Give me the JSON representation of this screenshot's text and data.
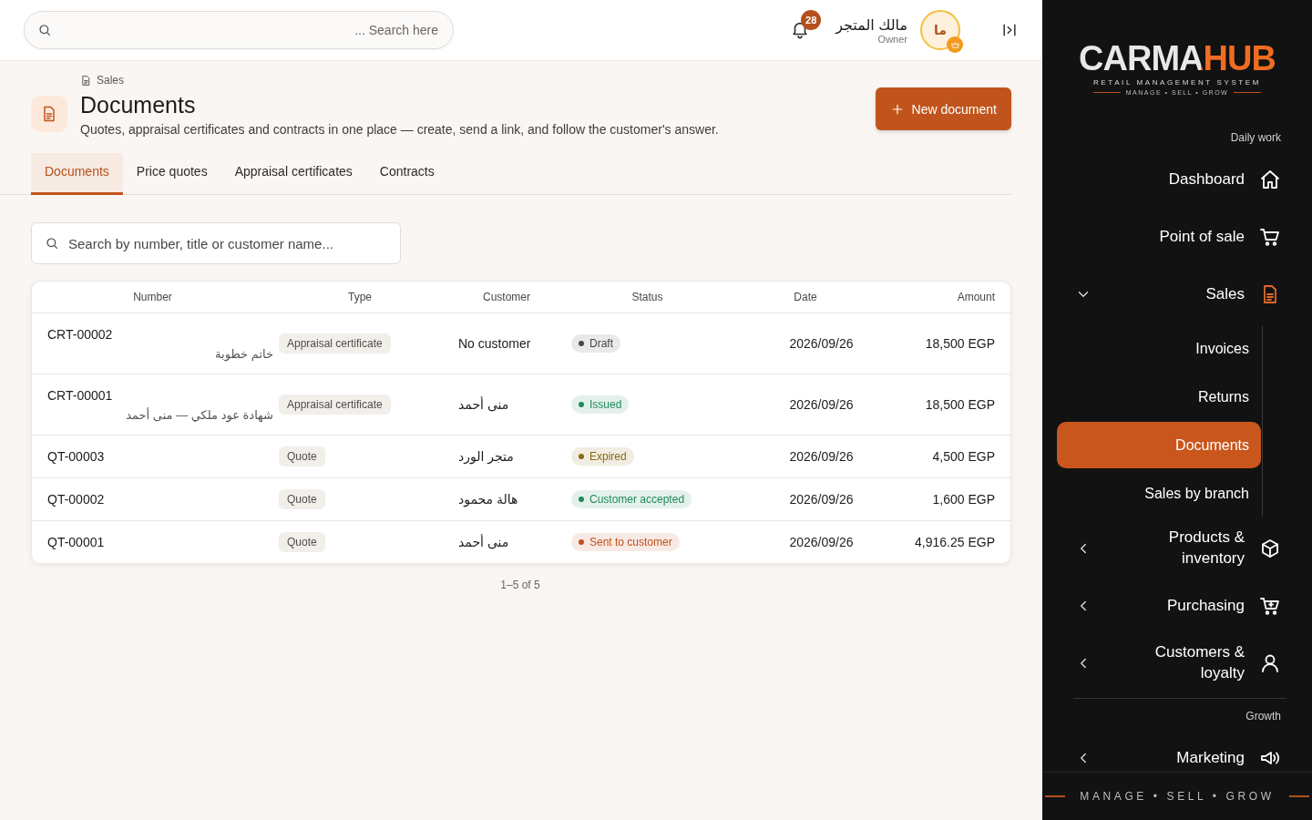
{
  "topbar": {
    "search": {
      "placeholder": "... Search here"
    },
    "notifications": {
      "count": "28"
    },
    "user": {
      "name": "مالك المتجر",
      "role": "Owner",
      "initials": "ما"
    }
  },
  "page": {
    "breadcrumb": "Sales",
    "title": "Documents",
    "subtitle": "Quotes, appraisal certificates and contracts in one place — create, send a link, and follow the customer's answer.",
    "new_button": "New document"
  },
  "tabs": [
    {
      "label": "Documents",
      "selected": true
    },
    {
      "label": "Price quotes",
      "selected": false
    },
    {
      "label": "Appraisal certificates",
      "selected": false
    },
    {
      "label": "Contracts",
      "selected": false
    }
  ],
  "search": {
    "placeholder": "Search by number, title or customer name..."
  },
  "table": {
    "columns": [
      "Number",
      "Type",
      "Customer",
      "Status",
      "Date",
      "Amount"
    ],
    "rows": [
      {
        "number": "CRT-00002",
        "title": "خاتم خطوبة",
        "type": "Appraisal certificate",
        "customer": "No customer",
        "status": {
          "label": "Draft",
          "color": "#4a4745"
        },
        "date": "2026/09/26",
        "amount": "18,500 EGP"
      },
      {
        "number": "CRT-00001",
        "title": "شهادة عود ملكي — منى أحمد",
        "type": "Appraisal certificate",
        "customer": "منى أحمد",
        "status": {
          "label": "Issued",
          "color": "#1f8a5b"
        },
        "date": "2026/09/26",
        "amount": "18,500 EGP"
      },
      {
        "number": "QT-00003",
        "type": "Quote",
        "customer": "متجر الورد",
        "status": {
          "label": "Expired",
          "color": "#8a6a10"
        },
        "date": "2026/09/26",
        "amount": "4,500 EGP"
      },
      {
        "number": "QT-00002",
        "type": "Quote",
        "customer": "هالة محمود",
        "status": {
          "label": "Customer accepted",
          "color": "#1f8a5b"
        },
        "date": "2026/09/26",
        "amount": "1,600 EGP"
      },
      {
        "number": "QT-00001",
        "type": "Quote",
        "customer": "منى أحمد",
        "status": {
          "label": "Sent to customer",
          "color": "#c0501a"
        },
        "date": "2026/09/26",
        "amount": "4,916.25 EGP"
      }
    ],
    "pagination": "1–5 of 5"
  },
  "sidebar": {
    "logo": {
      "name": "CARMAHUB",
      "tagline": "RETAIL MANAGEMENT SYSTEM",
      "motto": "MANAGE • SELL • GROW"
    },
    "sections": [
      {
        "label": "Daily work",
        "items": [
          {
            "kind": "link",
            "label": "Dashboard"
          },
          {
            "kind": "link",
            "label": "Point of sale"
          },
          {
            "kind": "group",
            "label": "Sales",
            "expanded": true,
            "children": [
              {
                "label": "Invoices",
                "selected": false
              },
              {
                "label": "Returns",
                "selected": false
              },
              {
                "label": "Documents",
                "selected": true
              },
              {
                "label": "Sales by branch",
                "selected": false
              }
            ]
          },
          {
            "kind": "group",
            "label": "Products & inventory",
            "expanded": false
          },
          {
            "kind": "group",
            "label": "Purchasing",
            "expanded": false
          },
          {
            "kind": "group",
            "label": "Customers & loyalty",
            "expanded": false
          }
        ]
      },
      {
        "label": "Growth",
        "items": [
          {
            "kind": "group",
            "label": "Marketing",
            "expanded": false
          }
        ]
      }
    ],
    "footer": "MANAGE • SELL • GROW"
  }
}
